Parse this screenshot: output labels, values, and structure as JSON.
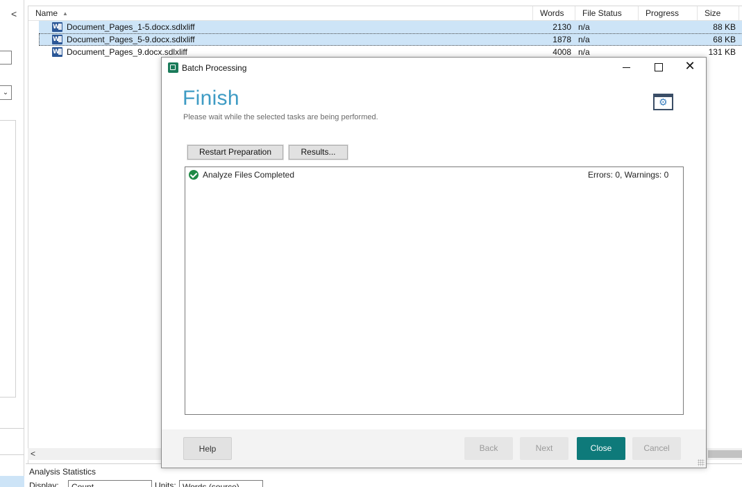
{
  "left_panel": {
    "collapse_glyph": "<",
    "dropdown_glyph": "⌄"
  },
  "file_list": {
    "columns": {
      "name": "Name",
      "words": "Words",
      "file_status": "File Status",
      "progress": "Progress",
      "size": "Size"
    },
    "sort_glyph": "▲",
    "rows": [
      {
        "name": "Document_Pages_1-5.docx.sdlxliff",
        "words": "2130",
        "status": "n/a",
        "size": "88 KB"
      },
      {
        "name": "Document_Pages_5-9.docx.sdlxliff",
        "words": "1878",
        "status": "n/a",
        "size": "68 KB"
      },
      {
        "name": "Document_Pages_9.docx.sdlxliff",
        "words": "4008",
        "status": "n/a",
        "size": "131 KB"
      }
    ],
    "scroll_left_glyph": "<"
  },
  "analysis": {
    "title": "Analysis Statistics",
    "display_label": "Display:",
    "display_value": "Count",
    "units_label": "Units:",
    "units_value": "Words (source)"
  },
  "dialog": {
    "title": "Batch Processing",
    "close_glyph": "✕",
    "heading": "Finish",
    "subheading": "Please wait while the selected tasks are being performed.",
    "restart_button": "Restart Preparation",
    "results_button": "Results...",
    "task": {
      "name": "Analyze Files",
      "status": "Completed",
      "summary": "Errors: 0, Warnings: 0"
    },
    "footer": {
      "help": "Help",
      "back": "Back",
      "next": "Next",
      "close": "Close",
      "cancel": "Cancel"
    },
    "accent_color": "#3e9bc4",
    "primary_button_color": "#0e7a7a"
  }
}
